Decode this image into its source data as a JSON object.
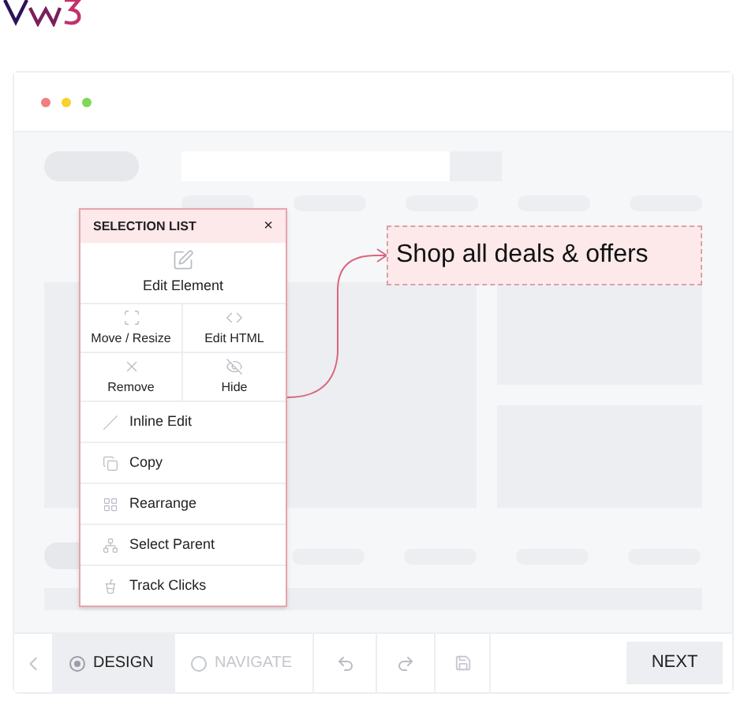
{
  "panel": {
    "title": "SELECTION LIST",
    "close": "×",
    "primary": {
      "label": "Edit Element",
      "kind": "edit"
    },
    "grid": [
      {
        "label": "Move / Resize",
        "kind": "move"
      },
      {
        "label": "Edit HTML",
        "kind": "code"
      },
      {
        "label": "Remove",
        "kind": "remove"
      },
      {
        "label": "Hide",
        "kind": "hide"
      }
    ],
    "items": [
      {
        "label": "Inline Edit",
        "kind": "inline"
      },
      {
        "label": "Copy",
        "kind": "copy"
      },
      {
        "label": "Rearrange",
        "kind": "rearrange"
      },
      {
        "label": "Select Parent",
        "kind": "parent"
      },
      {
        "label": "Track Clicks",
        "kind": "track"
      }
    ]
  },
  "callout": {
    "text": "Shop all deals & offers"
  },
  "toolbar": {
    "modes": [
      {
        "label": "DESIGN",
        "selected": true
      },
      {
        "label": "NAVIGATE",
        "selected": false
      }
    ],
    "next": "NEXT"
  }
}
